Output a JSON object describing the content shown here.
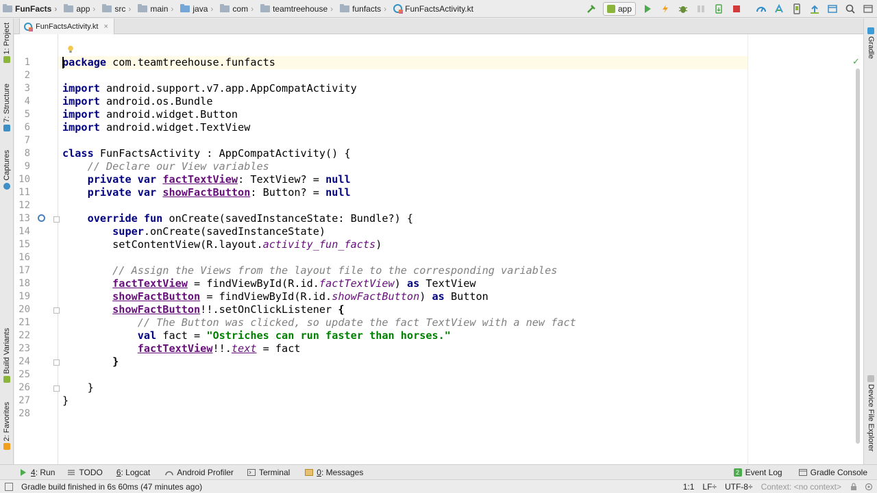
{
  "navbar": {
    "breadcrumbs": [
      "FunFacts",
      "app",
      "src",
      "main",
      "java",
      "com",
      "teamtreehouse",
      "funfacts",
      "FunFactsActivity.kt"
    ]
  },
  "toolbar": {
    "run_config": "app",
    "icons": [
      "make-project-icon",
      "run-icon",
      "apply-changes-icon",
      "debug-icon",
      "attach-debugger-icon",
      "stop-icon",
      "profile-icon",
      "sync-gradle-icon",
      "avd-manager-icon",
      "sdk-manager-icon",
      "search-icon"
    ]
  },
  "tabs": [
    {
      "label": "FunFactsActivity.kt"
    }
  ],
  "left_strip": {
    "project": "1: Project",
    "structure": "7: Structure",
    "captures": "Captures",
    "build_variants": "Build Variants",
    "favorites": "2: Favorites"
  },
  "right_strip": {
    "gradle": "Gradle",
    "device_explorer": "Device File Explorer"
  },
  "editor": {
    "lines": [
      {
        "n": "1",
        "html": "<span class=\"kw\">package</span> com.teamtreehouse.funfacts"
      },
      {
        "n": "2",
        "html": ""
      },
      {
        "n": "3",
        "html": "<span class=\"kw\">import</span> android.support.v7.app.AppCompatActivity"
      },
      {
        "n": "4",
        "html": "<span class=\"kw\">import</span> android.os.Bundle"
      },
      {
        "n": "5",
        "html": "<span class=\"kw\">import</span> android.widget.Button"
      },
      {
        "n": "6",
        "html": "<span class=\"kw\">import</span> android.widget.TextView"
      },
      {
        "n": "7",
        "html": ""
      },
      {
        "n": "8",
        "html": "<span class=\"kw\">class</span> FunFactsActivity : AppCompatActivity() {"
      },
      {
        "n": "9",
        "html": "    <span class=\"cm\">// Declare our View variables</span>"
      },
      {
        "n": "10",
        "html": "    <span class=\"kw\">private var</span> <span class=\"fld\">factTextView</span>: TextView? = <span class=\"kw\">null</span>"
      },
      {
        "n": "11",
        "html": "    <span class=\"kw\">private var</span> <span class=\"fld\">showFactButton</span>: Button? = <span class=\"kw\">null</span>"
      },
      {
        "n": "12",
        "html": ""
      },
      {
        "n": "13",
        "html": "    <span class=\"kw\">override fun</span> onCreate(savedInstanceState: Bundle?) {"
      },
      {
        "n": "14",
        "html": "        <span class=\"kw\">super</span>.onCreate(savedInstanceState)"
      },
      {
        "n": "15",
        "html": "        setContentView(R.layout.<span class=\"fld-it\">activity_fun_facts</span>)"
      },
      {
        "n": "16",
        "html": ""
      },
      {
        "n": "17",
        "html": "        <span class=\"cm\">// Assign the Views from the layout file to the corresponding variables</span>"
      },
      {
        "n": "18",
        "html": "        <span class=\"fld\">factTextView</span> = findViewById(R.id.<span class=\"fld-it\">factTextView</span>) <span class=\"kw\">as</span> TextView"
      },
      {
        "n": "19",
        "html": "        <span class=\"fld\">showFactButton</span> = findViewById(R.id.<span class=\"fld-it\">showFactButton</span>) <span class=\"kw\">as</span> Button"
      },
      {
        "n": "20",
        "html": "        <span class=\"fld\">showFactButton</span>!!.setOnClickListener <b>{</b>"
      },
      {
        "n": "21",
        "html": "            <span class=\"cm\">// The Button was clicked, so update the fact TextView with a new fact</span>"
      },
      {
        "n": "22",
        "html": "            <span class=\"kw\">val</span> fact = <span class=\"str\">\"Ostriches can run faster than horses.\"</span>"
      },
      {
        "n": "23",
        "html": "            <span class=\"fld\">factTextView</span>!!.<span class=\"prop\">text</span> = fact"
      },
      {
        "n": "24",
        "html": "        <b>}</b>"
      },
      {
        "n": "25",
        "html": ""
      },
      {
        "n": "26",
        "html": "    }"
      },
      {
        "n": "27",
        "html": "}"
      },
      {
        "n": "28",
        "html": ""
      }
    ]
  },
  "bottombar": {
    "run": {
      "num": "4",
      "label": ": Run"
    },
    "todo": "TODO",
    "logcat": {
      "num": "6",
      "label": ": Logcat"
    },
    "profiler": "Android Profiler",
    "terminal": "Terminal",
    "messages": {
      "num": "0",
      "label": ": Messages"
    },
    "event_log": "Event Log",
    "event_log_count": "2",
    "gradle_console": "Gradle Console"
  },
  "statusbar": {
    "message": "Gradle build finished in 6s 60ms (47 minutes ago)",
    "position": "1:1",
    "line_separator": "LF÷",
    "encoding": "UTF-8÷",
    "context": "Context: <no context>"
  }
}
